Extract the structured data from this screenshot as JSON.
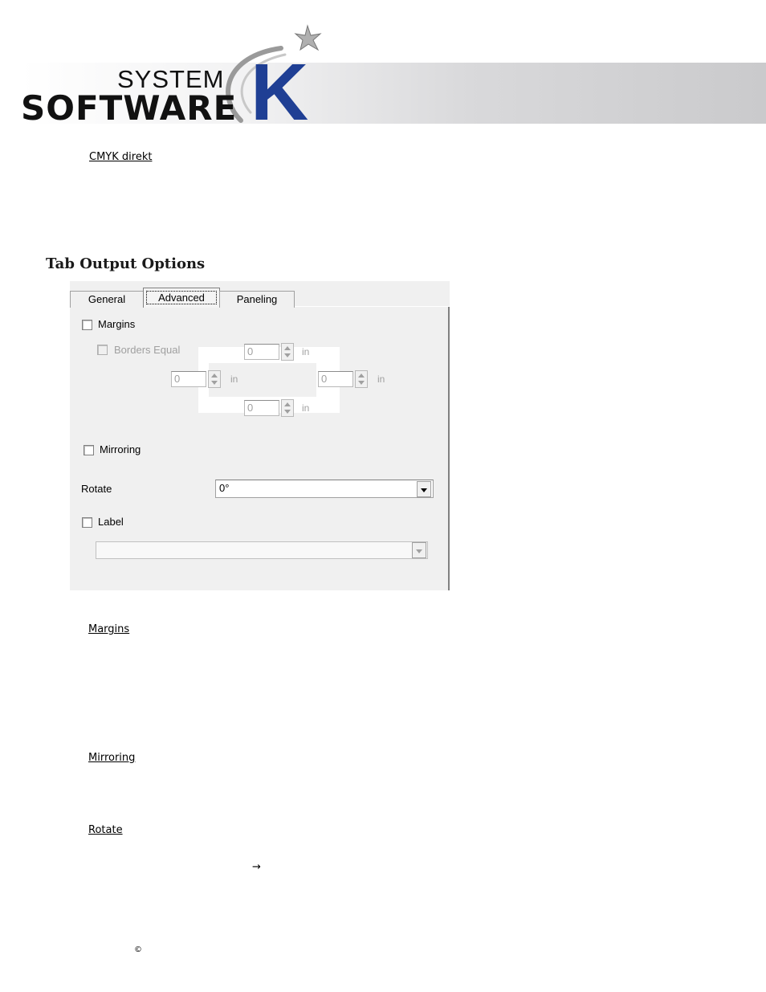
{
  "header": {
    "logo_system": "SYSTEM",
    "logo_software": "SOFTWARE",
    "logo_k": "K"
  },
  "sections": {
    "cmyk": "CMYK direkt",
    "tab_heading": "Tab Output Options",
    "margins": "Margins",
    "mirroring": "Mirroring",
    "rotate": "Rotate"
  },
  "dialog": {
    "tabs": [
      {
        "label": "General"
      },
      {
        "label": "Advanced"
      },
      {
        "label": "Paneling"
      }
    ],
    "active_tab": "Advanced",
    "margins_label": "Margins",
    "margins_checked": false,
    "borders_equal_label": "Borders Equal",
    "borders_equal_checked": false,
    "top_value": "0",
    "left_value": "0",
    "right_value": "0",
    "bottom_value": "0",
    "unit": "in",
    "mirroring_label": "Mirroring",
    "mirroring_checked": false,
    "rotate_label": "Rotate",
    "rotate_value": "0°",
    "label_label": "Label",
    "label_checked": false,
    "label_value": ""
  },
  "footer": {
    "arrow": "→",
    "copyright": "©"
  }
}
